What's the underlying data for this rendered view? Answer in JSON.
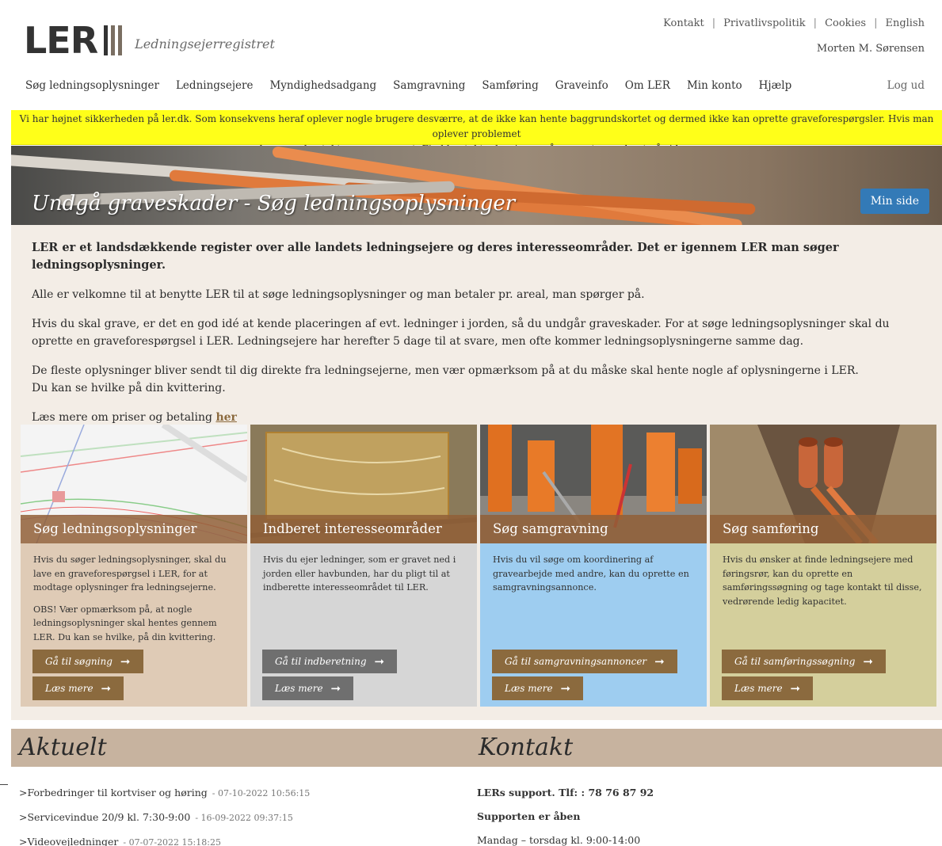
{
  "header": {
    "logo_text": "LER",
    "logo_subtitle": "Ledningsejerregistret",
    "toplinks": [
      "Kontakt",
      "Privatlivspolitik",
      "Cookies",
      "English"
    ],
    "username": "Morten M. Sørensen",
    "nav": [
      "Søg ledningsoplysninger",
      "Ledningsejere",
      "Myndighedsadgang",
      "Samgravning",
      "Samføring",
      "Graveinfo",
      "Om LER",
      "Min konto",
      "Hjælp"
    ],
    "logout": "Log ud"
  },
  "notice": {
    "line1": "Vi har højnet sikkerheden på ler.dk. Som konsekvens heraf oplever nogle brugere desværre, at de ikke kan hente baggrundskortet og dermed ikke kan oprette graveforespørgsler. Hvis man oplever problemet",
    "line2": "kan man kontakte vores support. Find kontaktoplysninger på supporten nederst på siden.",
    "color": "#ffff19"
  },
  "hero": {
    "title": "Undgå graveskader - Søg ledningsoplysninger",
    "button": "Min side"
  },
  "intro": {
    "lead": "LER er et landsdækkende register over alle landets ledningsejere og deres interesseområder. Det er igennem LER man søger ledningsoplysninger.",
    "p1": "Alle er velkomne til at benytte LER til at søge ledningsoplysninger og man betaler pr. areal, man spørger på.",
    "p2": "Hvis du skal grave, er det en god idé at kende placeringen af evt. ledninger i jorden, så du undgår graveskader. For at søge ledningsoplysninger skal du oprette en graveforespørgsel i LER. Ledningsejere har herefter 5 dage til at svare, men ofte kommer ledningsoplysningerne samme dag.",
    "p3a": "De fleste oplysninger bliver sendt til dig direkte fra ledningsejerne, men vær opmærksom på at du måske skal hente nogle af oplysningerne i LER.",
    "p3b": "Du kan se hvilke på din kvittering.",
    "p4": "Læs mere om priser og betaling",
    "p4_link": "her"
  },
  "cards": [
    {
      "title": "Søg ledningsoplysninger",
      "text": "Hvis du søger ledningsoplysninger, skal du lave en graveforespørgsel i LER, for at modtage oplysninger fra ledningsejerne.",
      "note": "OBS! Vær opmærksom på, at nogle ledningsoplysninger skal hentes gennem LER. Du kan se hvilke, på din kvittering.",
      "btn1": "Gå til søgning",
      "btn2": "Læs mere"
    },
    {
      "title": "Indberet interesseområder",
      "text": "Hvis du ejer ledninger, som er gravet ned i jorden eller havbunden, har du pligt til at indberette interesseområdet til LER.",
      "btn1": "Gå til indberetning",
      "btn2": "Læs mere"
    },
    {
      "title": "Søg samgravning",
      "text": "Hvis du vil søge om koordinering af gravearbejde med andre, kan du oprette en samgravningsannonce.",
      "btn1": "Gå til samgravningsannoncer",
      "btn2": "Læs mere"
    },
    {
      "title": "Søg samføring",
      "text": "Hvis du ønsker at finde ledningsejere med føringsrør, kan du oprette en samføringssøgning og tage kontakt til disse, vedrørende ledig kapacitet.",
      "btn1": "Gå til samføringssøgning",
      "btn2": "Læs mere"
    }
  ],
  "aktuelt": {
    "title": "Aktuelt",
    "items": [
      {
        "text": ">Forbedringer til kortviser og høring",
        "date": "- 07-10-2022 10:56:15"
      },
      {
        "text": ">Servicevindue 20/9 kl. 7:30-9:00",
        "date": "- 16-09-2022 09:37:15"
      },
      {
        "text": ">Videovejledninger",
        "date": "- 07-07-2022 15:18:25"
      }
    ]
  },
  "kontakt": {
    "title": "Kontakt",
    "support": "LERs support. Tlf: : 78 76 87 92",
    "open": "Supporten er åben",
    "hours": "Mandag – torsdag kl. 9:00-14:00"
  }
}
